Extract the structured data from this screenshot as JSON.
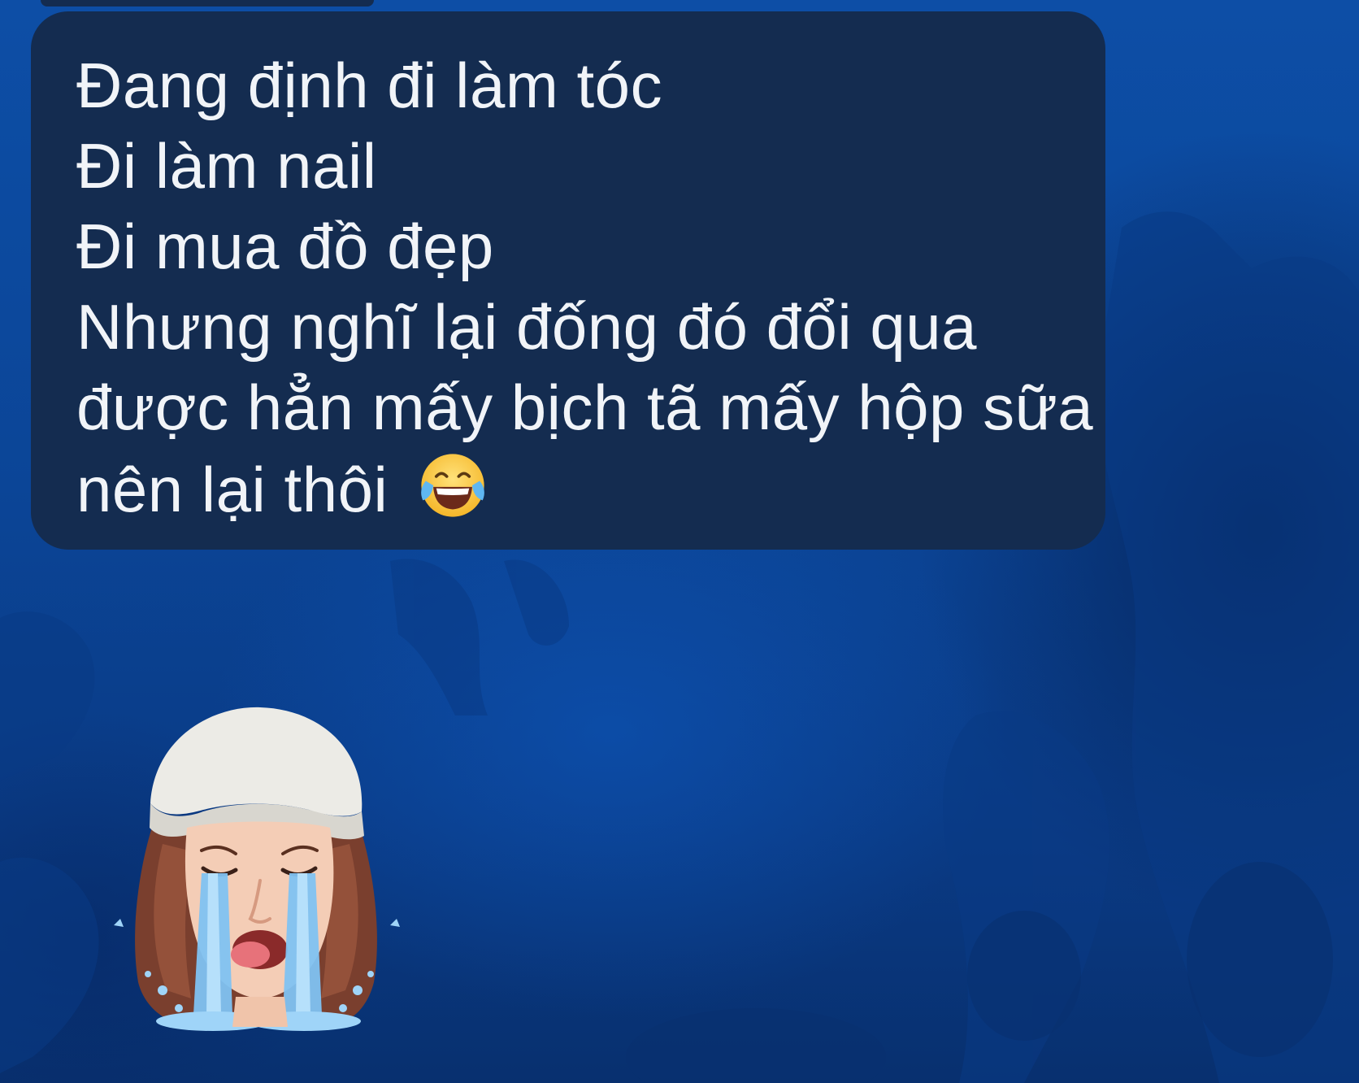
{
  "message": {
    "lines": [
      "Đang định đi làm tóc",
      "Đi làm nail",
      "Đi mua đồ đẹp",
      "Nhưng nghĩ lại đống đó đổi qua",
      "được hẳn mấy bịch tã mấy hộp sữa",
      "nên lại thôi"
    ],
    "emoji": "face-with-tears-of-joy-icon"
  },
  "sticker": {
    "icon": "crying-avatar-sticker"
  },
  "colors": {
    "background": "#0b4597",
    "bubble": "#142c50",
    "text": "#f1f4f8"
  }
}
